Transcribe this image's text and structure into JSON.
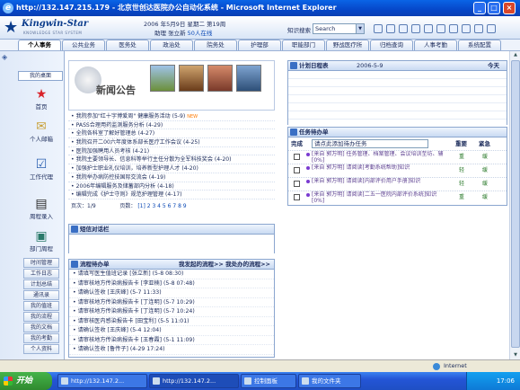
{
  "window": {
    "title": "http://132.147.215.179 - 北京世创达医院办公自动化系统 - Microsoft Internet Explorer",
    "buttons": [
      "_",
      "□",
      "×"
    ]
  },
  "header": {
    "logo_name": "Kingwin-Star",
    "logo_sub": "KNOWLEDGE STAR SYSTEM",
    "date": "2006 年5月9日 星期二  第19周",
    "user_prefix": "助理 张立新",
    "online": "50人在线",
    "search_label": "知识搜索",
    "search_value": "Search"
  },
  "nav": {
    "tabs": [
      "个人事务",
      "公共业务",
      "医务处",
      "政治处",
      "院务处",
      "护理部",
      "职能部门",
      "野战医疗所",
      "归档查询",
      "人事考勤",
      "系统配置"
    ]
  },
  "sidebar": {
    "top": "我的桌面",
    "icons": [
      {
        "label": "首页",
        "glyph": "★",
        "color": "#d9232b"
      },
      {
        "label": "个人邮箱",
        "glyph": "✉",
        "color": "#c9a23a"
      },
      {
        "label": "工作代理",
        "glyph": "☑",
        "color": "#2a5fb0"
      },
      {
        "label": "周程录入",
        "glyph": "▤",
        "color": "#2a2a2a"
      },
      {
        "label": "部门周程",
        "glyph": "▣",
        "color": "#2a7a6a"
      }
    ],
    "menu": [
      "时间管理",
      "工作日志",
      "计划总结",
      "通讯录",
      "我的值班",
      "我的流程",
      "我的文档",
      "我的考勤",
      "个人资料"
    ]
  },
  "news": {
    "title": "新闻公告",
    "items": [
      "我院参加\"红十字博爱周\" 健康服务活动 (5-9)",
      "PASS合理用药监测服务分析 (4-29)",
      "全院各科室了解好管理总 (4-27)",
      "我院召开二00六年度体系部长医疗工作会议 (4-25)",
      "医院加强聘用人员考核 (4-21)",
      "我院主要领导长、信息科等举行主任分散为全军科技奖会 (4-20)",
      "加强护士职业礼仪培训，培养新型护理人才 (4-20)",
      "我院举办病防控技国际交流会 (4-19)",
      "2006年编辑服务及储蓄部内分析 (4-18)",
      "编辑完成《护士守则》规范护理管理 (4-17)"
    ],
    "new_badge": "NEW",
    "pager_left": "页次：1/9",
    "pager_right": "页数：",
    "pages": "[1] 2 3 4 5 6 7 8 9"
  },
  "schedule": {
    "title": "计划日程表",
    "date": "2006-5-9",
    "today": "今天"
  },
  "tasks": {
    "title": "任务待办单",
    "done_label": "完成",
    "input_placeholder": "请点此添加待办任务",
    "col_importance": "重要",
    "col_urgency": "紧急",
    "rows": [
      {
        "text": "[来自 郭万明] 任务管理、档案管理、会议培训至坊、辅[0%]",
        "imp": "重",
        "urg": "缓"
      },
      {
        "text": "[来自 郭万明] 请阅读[考勤系统帮助]知识",
        "imp": "轻",
        "urg": "缓"
      },
      {
        "text": "[来自 郭万明] 请阅读[内部评价用户手册]知识",
        "imp": "轻",
        "urg": "缓"
      },
      {
        "text": "[来自 郭万明] 请阅读[二五一医院内部评价系统]知识[0%]",
        "imp": "重",
        "urg": "缓"
      }
    ]
  },
  "sms": {
    "title": "短信对话栏"
  },
  "flow": {
    "title": "流程待办单",
    "links": "我发起的流程>> 我处办的流程>>",
    "items": [
      "请填写医生值班记录 [张立新] (5-8 08:30)",
      "请审核地方传染病报告卡 [李亚楠] (5-8 07:48)",
      "请确认签收 [王庆峰] (5-7 11:33)",
      "请审核地方传染病报告卡 [丁连明] (5-7 10:29)",
      "请审核地方传染病报告卡 [丁连明] (5-7 10:24)",
      "请审核医内感染报告卡 [田宝利] (5-5 11:01)",
      "请确认签收 [王庆峰] (5-4 12:04)",
      "请审核地方传染病报告卡 [王春霞] (5-1 11:09)",
      "请确认签收 [鲁传子] (4-29 17:24)"
    ]
  },
  "statusbar": {
    "zone": "Internet"
  },
  "taskbar": {
    "start": "开始",
    "buttons": [
      "http://132.147.2...",
      "http://132.147.2...",
      "控制面板",
      "我的文件夹"
    ],
    "clock": "17:06"
  }
}
